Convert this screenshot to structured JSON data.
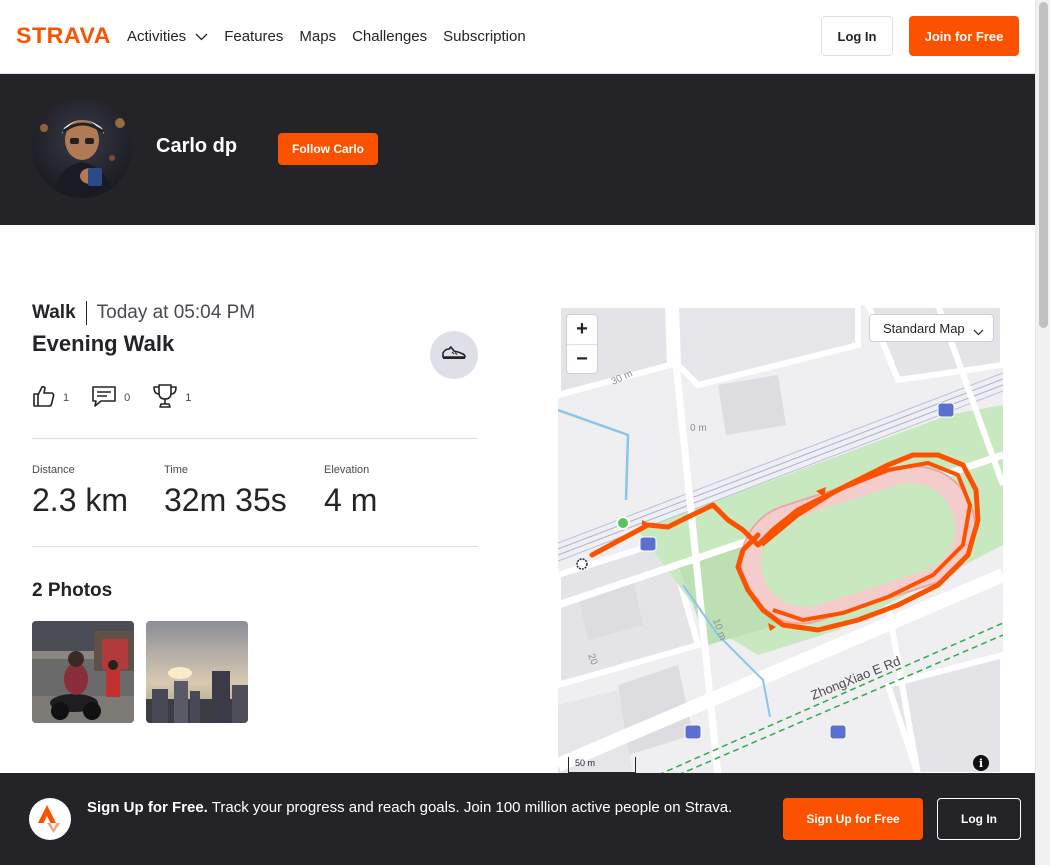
{
  "nav": {
    "logo_text": "STRAVA",
    "links": [
      "Activities",
      "Features",
      "Maps",
      "Challenges",
      "Subscription"
    ],
    "login_label": "Log In",
    "join_label": "Join for Free"
  },
  "profile": {
    "athlete_name": "Carlo dp",
    "follow_label": "Follow Carlo"
  },
  "activity": {
    "type": "Walk",
    "time": "Today at 05:04 PM",
    "title": "Evening Walk",
    "kudos_count": "1",
    "comments_count": "0",
    "achievements_count": "1",
    "stats": [
      {
        "label": "Distance",
        "value": "2.3 km"
      },
      {
        "label": "Time",
        "value": "32m 35s"
      },
      {
        "label": "Elevation",
        "value": "4 m"
      }
    ],
    "photos_title": "2 Photos"
  },
  "map": {
    "zoom_in": "+",
    "zoom_out": "−",
    "style_label": "Standard Map",
    "scale_label": "50 m",
    "info_label": "i",
    "street_label": "ZhongXiao E Rd",
    "contour_labels": [
      "30 m",
      "0 m",
      "10 m",
      "20"
    ],
    "route_color": "#fc5200",
    "start_color": "#5cc25c"
  },
  "banner": {
    "headline": "Sign Up for Free.",
    "body": "Track your progress and reach goals. Join 100 million active people on Strava.",
    "signup_label": "Sign Up for Free",
    "login_label": "Log In"
  },
  "colors": {
    "brand": "#fc5200",
    "dark": "#242428"
  }
}
